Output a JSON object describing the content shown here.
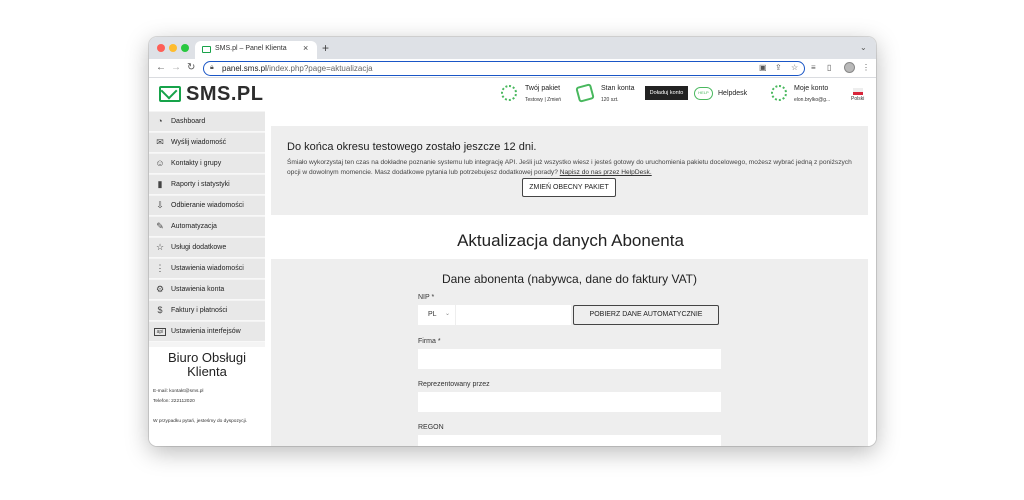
{
  "browser": {
    "tab_title": "SMS.pl – Panel Klienta",
    "tab_close": "×",
    "new_tab": "+",
    "url_host": "panel.sms.pl",
    "url_path": "/index.php?page=aktualizacja"
  },
  "header": {
    "logo": "SMS.PL",
    "package": {
      "label": "Twój pakiet",
      "sub": "Testowy | Zmień"
    },
    "balance": {
      "label": "Stan konta",
      "sub": "120 szt."
    },
    "topup_label": "Doładuj konto",
    "helpdesk_badge": "HELP",
    "helpdesk_label": "Helpdesk",
    "account": {
      "label": "Moje konto",
      "sub": "elon.brylko@g..."
    },
    "language": "Polski"
  },
  "sidebar": {
    "items": [
      {
        "label": "Dashboard",
        "icon": "◔"
      },
      {
        "label": "Wyślij wiadomość",
        "icon": "✉"
      },
      {
        "label": "Kontakty i grupy",
        "icon": "☺"
      },
      {
        "label": "Raporty i statystyki",
        "icon": "▮"
      },
      {
        "label": "Odbieranie wiadomości",
        "icon": "⇩"
      },
      {
        "label": "Automatyzacja",
        "icon": "✎"
      },
      {
        "label": "Usługi dodatkowe",
        "icon": "☆"
      },
      {
        "label": "Ustawienia wiadomości",
        "icon": "⋮"
      },
      {
        "label": "Ustawienia konta",
        "icon": "⚙"
      },
      {
        "label": "Faktury i płatności",
        "icon": "$"
      },
      {
        "label": "Ustawienia interfejsów",
        "icon": "api"
      }
    ],
    "support": {
      "title": "Biuro Obsługi Klienta",
      "email": "E-mail: kontakt@sms.pl",
      "phone": "Telefon: 222112020",
      "note": "W przypadku pytań, jesteśmy do dyspozycji."
    }
  },
  "notice": {
    "title": "Do końca okresu testowego zostało jeszcze 12 dni.",
    "text": "Śmiało wykorzystaj ten czas na dokładne poznanie systemu lub integrację API. Jeśli już wszystko wiesz i jesteś gotowy do uruchomienia pakietu docelowego, możesz wybrać jedną z poniższych opcji w dowolnym momencie. Masz dodatkowe pytania lub potrzebujesz dodatkowej porady? ",
    "link": "Napisz do nas przez HelpDesk.",
    "button": "ZMIEŃ OBECNY PAKIET"
  },
  "page": {
    "title": "Aktualizacja danych Abonenta"
  },
  "form": {
    "title": "Dane abonenta (nabywca, dane do faktury VAT)",
    "nip_label": "NIP *",
    "country_value": "PL",
    "fetch_button": "POBIERZ DANE AUTOMATYCZNIE",
    "company_label": "Firma *",
    "represented_label": "Reprezentowany przez",
    "regon_label": "REGON"
  }
}
